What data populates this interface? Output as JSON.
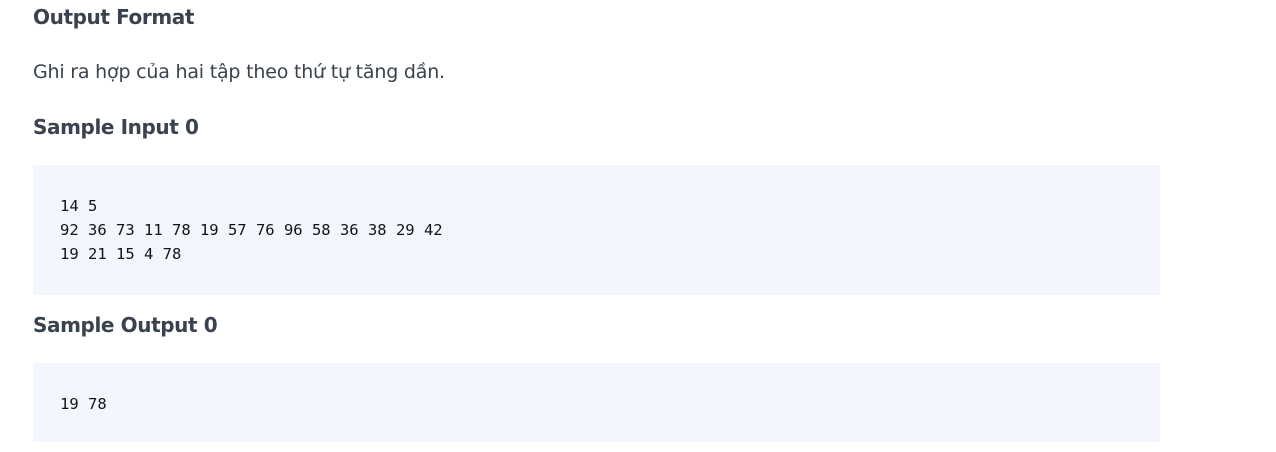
{
  "output_format": {
    "heading": "Output Format",
    "text": "Ghi ra hợp của hai tập theo thứ tự tăng dần."
  },
  "sample_input": {
    "heading": "Sample Input 0",
    "lines": [
      "14 5",
      "92 36 73 11 78 19 57 76 96 58 36 38 29 42",
      "19 21 15 4 78"
    ]
  },
  "sample_output": {
    "heading": "Sample Output 0",
    "lines": [
      "19 78"
    ]
  }
}
